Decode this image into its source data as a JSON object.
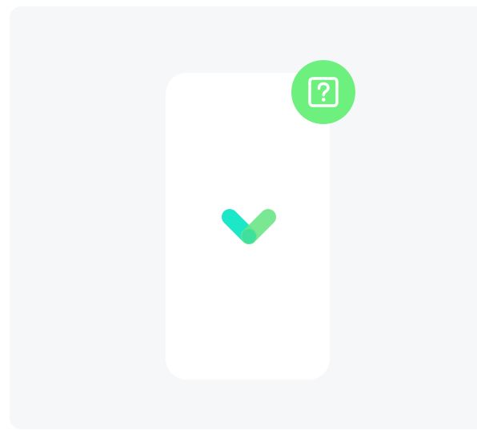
{
  "illustration": {
    "panel_color": "#f6f7f9",
    "phone_color": "#ffffff",
    "check_icon": "check-icon",
    "check_colors": {
      "left_stroke": "#1de7c9",
      "right_stroke": "#6fe68a",
      "overlap": "#3fe09c"
    }
  },
  "help_badge": {
    "icon": "question-box-icon",
    "color": "#6ef07f",
    "icon_color": "#ffffff"
  }
}
